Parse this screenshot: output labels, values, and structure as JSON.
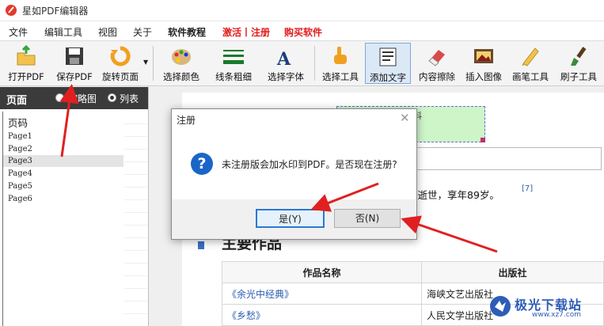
{
  "window": {
    "title": "星如PDF编辑器"
  },
  "menu": {
    "items": [
      "文件",
      "编辑工具",
      "视图",
      "关于",
      "软件教程",
      "激活丨注册",
      "购买软件"
    ]
  },
  "toolbar": {
    "items": [
      {
        "label": "打开PDF",
        "icon": "open-folder-icon"
      },
      {
        "label": "保存PDF",
        "icon": "save-floppy-icon"
      },
      {
        "label": "旋转页面",
        "icon": "rotate-icon"
      },
      {
        "label": "选择颜色",
        "icon": "palette-icon"
      },
      {
        "label": "线条粗细",
        "icon": "line-width-icon"
      },
      {
        "label": "选择字体",
        "icon": "font-icon"
      },
      {
        "label": "选择工具",
        "icon": "pointer-hand-icon"
      },
      {
        "label": "添加文字",
        "icon": "add-text-icon"
      },
      {
        "label": "内容擦除",
        "icon": "eraser-icon"
      },
      {
        "label": "插入图像",
        "icon": "insert-image-icon"
      },
      {
        "label": "画笔工具",
        "icon": "pencil-icon"
      },
      {
        "label": "刷子工具",
        "icon": "brush-icon"
      }
    ],
    "active": "添加文字"
  },
  "panel": {
    "title": "页面",
    "view_thumb": "缩略图",
    "view_list": "列表",
    "view_selected": "列表",
    "column_header": "页码",
    "pages": [
      "Page1",
      "Page2",
      "Page3",
      "Page4",
      "Page5",
      "Page6"
    ],
    "selected_page": "Page3"
  },
  "document": {
    "selection_text": "料",
    "body_text": "湾逝世，享年89岁。",
    "ref_mark": "[7]",
    "section_title": "主要作品",
    "table": {
      "headers": [
        "作品名称",
        "出版社"
      ],
      "rows": [
        [
          "《余光中经典》",
          "海峡文艺出版社"
        ],
        [
          "《乡愁》",
          "人民文学出版社"
        ]
      ]
    }
  },
  "dialog": {
    "title": "注册",
    "message": "未注册版会加水印到PDF。是否现在注册?",
    "yes_label": "是(Y)",
    "no_label": "否(N)",
    "icon": "question-icon"
  },
  "watermark": {
    "text": "极光下载站",
    "url": "www.xz7.com"
  },
  "colors": {
    "accent": "#2b78d4",
    "menu_red": "#e21b1b",
    "arrow_red": "#e02020",
    "panel_header": "#3b3b3b"
  }
}
